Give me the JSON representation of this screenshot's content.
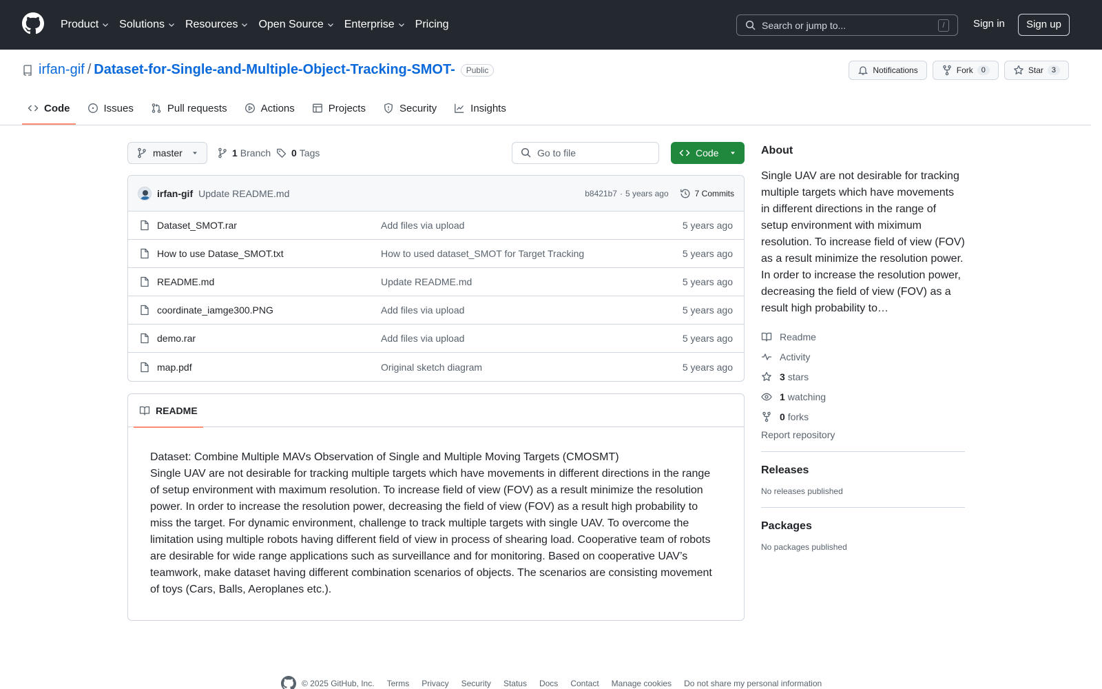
{
  "header": {
    "nav": [
      {
        "label": "Product",
        "dropdown": true
      },
      {
        "label": "Solutions",
        "dropdown": true
      },
      {
        "label": "Resources",
        "dropdown": true
      },
      {
        "label": "Open Source",
        "dropdown": true
      },
      {
        "label": "Enterprise",
        "dropdown": true
      },
      {
        "label": "Pricing",
        "dropdown": false
      }
    ],
    "search_placeholder": "Search or jump to...",
    "search_shortcut": "/",
    "signin": "Sign in",
    "signup": "Sign up"
  },
  "repo": {
    "owner": "irfan-gif",
    "separator": "/",
    "name": "Dataset-for-Single-and-Multiple-Object-Tracking-SMOT-",
    "visibility": "Public",
    "notifications_label": "Notifications",
    "fork_label": "Fork",
    "fork_count": "0",
    "star_label": "Star",
    "star_count": "3"
  },
  "tabs": [
    {
      "label": "Code",
      "icon": "code-icon",
      "active": true
    },
    {
      "label": "Issues",
      "icon": "issue-icon"
    },
    {
      "label": "Pull requests",
      "icon": "pull-request-icon"
    },
    {
      "label": "Actions",
      "icon": "play-icon"
    },
    {
      "label": "Projects",
      "icon": "table-icon"
    },
    {
      "label": "Security",
      "icon": "shield-icon"
    },
    {
      "label": "Insights",
      "icon": "graph-icon"
    }
  ],
  "toolbar": {
    "branch": "master",
    "branch_count": "1",
    "branch_label": "Branch",
    "tag_count": "0",
    "tag_label": "Tags",
    "goto_placeholder": "Go to file",
    "code_label": "Code"
  },
  "commit": {
    "author": "irfan-gif",
    "message": "Update README.md",
    "hash": "b8421b7",
    "dot": "·",
    "age": "5 years ago",
    "commits_label": "7 Commits"
  },
  "files": [
    {
      "name": "Dataset_SMOT.rar",
      "message": "Add files via upload",
      "date": "5 years ago"
    },
    {
      "name": "How to use Datase_SMOT.txt",
      "message": "How to used dataset_SMOT for Target Tracking",
      "date": "5 years ago"
    },
    {
      "name": "README.md",
      "message": "Update README.md",
      "date": "5 years ago"
    },
    {
      "name": "coordinate_iamge300.PNG",
      "message": "Add files via upload",
      "date": "5 years ago"
    },
    {
      "name": "demo.rar",
      "message": "Add files via upload",
      "date": "5 years ago"
    },
    {
      "name": "map.pdf",
      "message": "Original sketch diagram",
      "date": "5 years ago"
    }
  ],
  "readme": {
    "tab_label": "README",
    "title": "Dataset: Combine Multiple MAVs Observation of Single and Multiple Moving Targets (CMOSMT)",
    "body": "Single UAV are not desirable for tracking multiple targets which have movements in different directions in the range of setup environment with maximum resolution. To increase field of view (FOV) as a result minimize the resolution power. In order to increase the resolution power, decreasing the field of view (FOV) as a result high probability to miss the target. For dynamic environment, challenge to track multiple targets with single UAV. To overcome the limitation using multiple robots having different field of view in process of shearing load. Cooperative team of robots are desirable for wide range applications such as surveillance and for monitoring. Based on cooperative UAV’s teamwork, make dataset having different combination scenarios of objects. The scenarios are consisting movement of toys (Cars, Balls, Aeroplanes etc.)."
  },
  "about": {
    "heading": "About",
    "description": "Single UAV are not desirable for tracking multiple targets which have movements in different directions in the range of setup environment with miximum resolution. To increase field of view (FOV) as a result minimize the resolution power. In order to increase the resolution power, decreasing the field of view (FOV) as a result high probability to…",
    "readme": "Readme",
    "activity": "Activity",
    "stars_count": "3",
    "stars_label": "stars",
    "watching_count": "1",
    "watching_label": "watching",
    "forks_count": "0",
    "forks_label": "forks",
    "report": "Report repository"
  },
  "releases": {
    "heading": "Releases",
    "text": "No releases published"
  },
  "packages": {
    "heading": "Packages",
    "text": "No packages published"
  },
  "footer": {
    "copyright": "© 2025 GitHub, Inc.",
    "links": [
      "Terms",
      "Privacy",
      "Security",
      "Status",
      "Docs",
      "Contact",
      "Manage cookies",
      "Do not share my personal information"
    ]
  },
  "colors": {
    "header_bg": "#24292f",
    "accent_link": "#0969da",
    "code_button": "#1f883d",
    "tab_underline": "#fd8c73"
  }
}
